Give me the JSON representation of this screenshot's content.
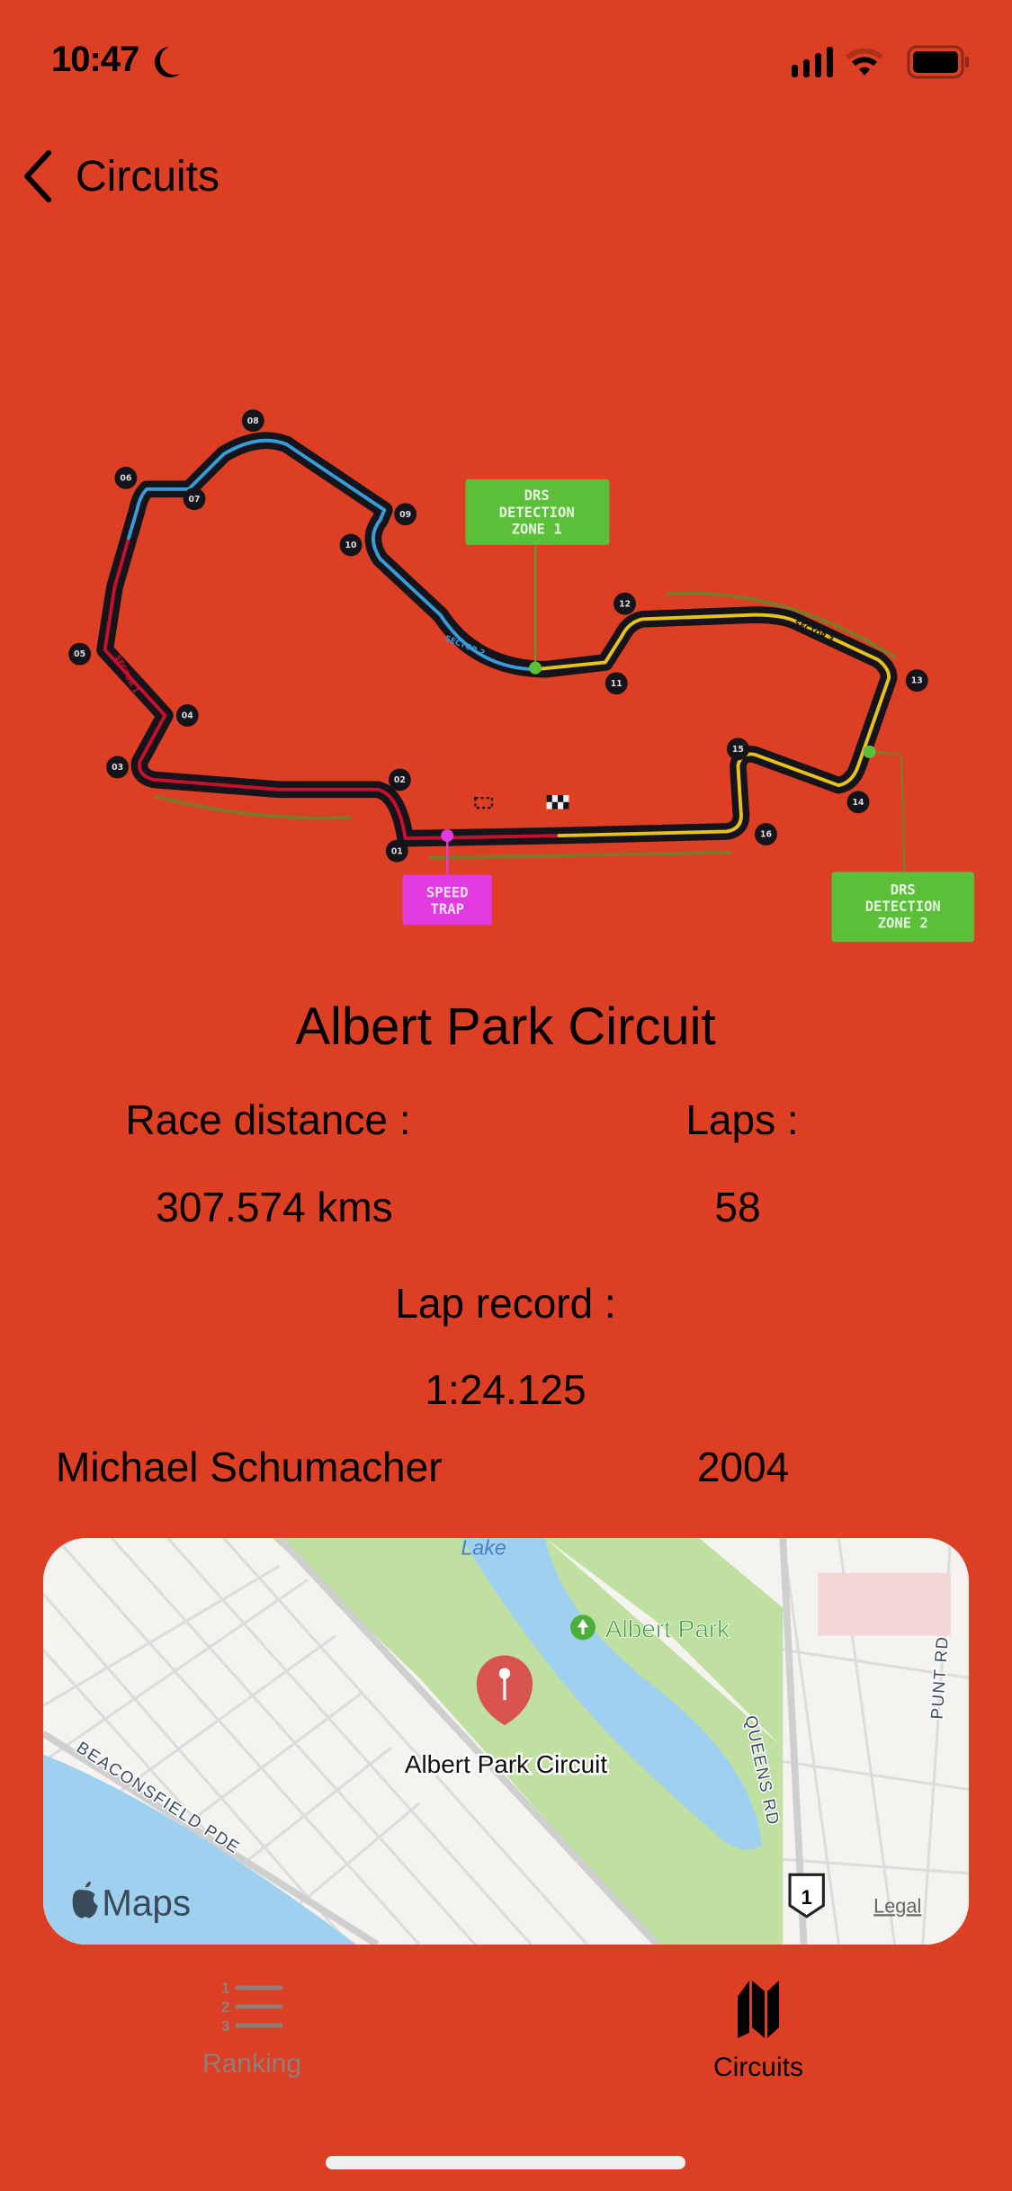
{
  "status_bar": {
    "time": "10:47",
    "icons": [
      "moon-icon",
      "cellular-signal-icon",
      "wifi-icon",
      "battery-icon"
    ]
  },
  "nav": {
    "back_label": "Circuits",
    "back_icon": "chevron-left-icon"
  },
  "track_map": {
    "turns": [
      "01",
      "02",
      "03",
      "04",
      "05",
      "06",
      "07",
      "08",
      "09",
      "10",
      "11",
      "12",
      "13",
      "14",
      "15",
      "16"
    ],
    "sector_labels": [
      "SECTOR 1",
      "SECTOR 2",
      "SECTOR 3"
    ],
    "drs_zone_1": [
      "DRS",
      "DETECTION",
      "ZONE 1"
    ],
    "drs_zone_2": [
      "DRS",
      "DETECTION",
      "ZONE 2"
    ],
    "speed_trap": [
      "SPEED",
      "TRAP"
    ],
    "colors": {
      "sector1": "#c8102e",
      "sector2": "#3a9bd9",
      "sector3": "#e8c21a",
      "drs": "#5bbf3a",
      "speed_trap": "#e03ae0"
    }
  },
  "circuit": {
    "name": "Albert Park Circuit",
    "race_distance_label": "Race distance :",
    "race_distance_value": "307.574 kms",
    "laps_label": "Laps :",
    "laps_value": "58",
    "lap_record_label": "Lap record :",
    "lap_record_time": "1:24.125",
    "lap_record_driver": "Michael Schumacher",
    "lap_record_year": "2004"
  },
  "map": {
    "pin_label": "Albert Park Circuit",
    "poi_label": "Albert Park",
    "lake_label": "Lake",
    "streets": [
      "BEACONSFIELD PDE",
      "QUEENS RD",
      "PUNT RD"
    ],
    "route_shield": "1",
    "brand": "Maps",
    "legal": "Legal"
  },
  "tab_bar": {
    "tabs": [
      {
        "label": "Ranking",
        "icon": "ranked-list-icon",
        "selected": false
      },
      {
        "label": "Circuits",
        "icon": "map-icon",
        "selected": true
      }
    ]
  },
  "colors": {
    "background": "#dc3f24",
    "tab_inactive": "#8e8078",
    "tab_active": "#000000"
  }
}
